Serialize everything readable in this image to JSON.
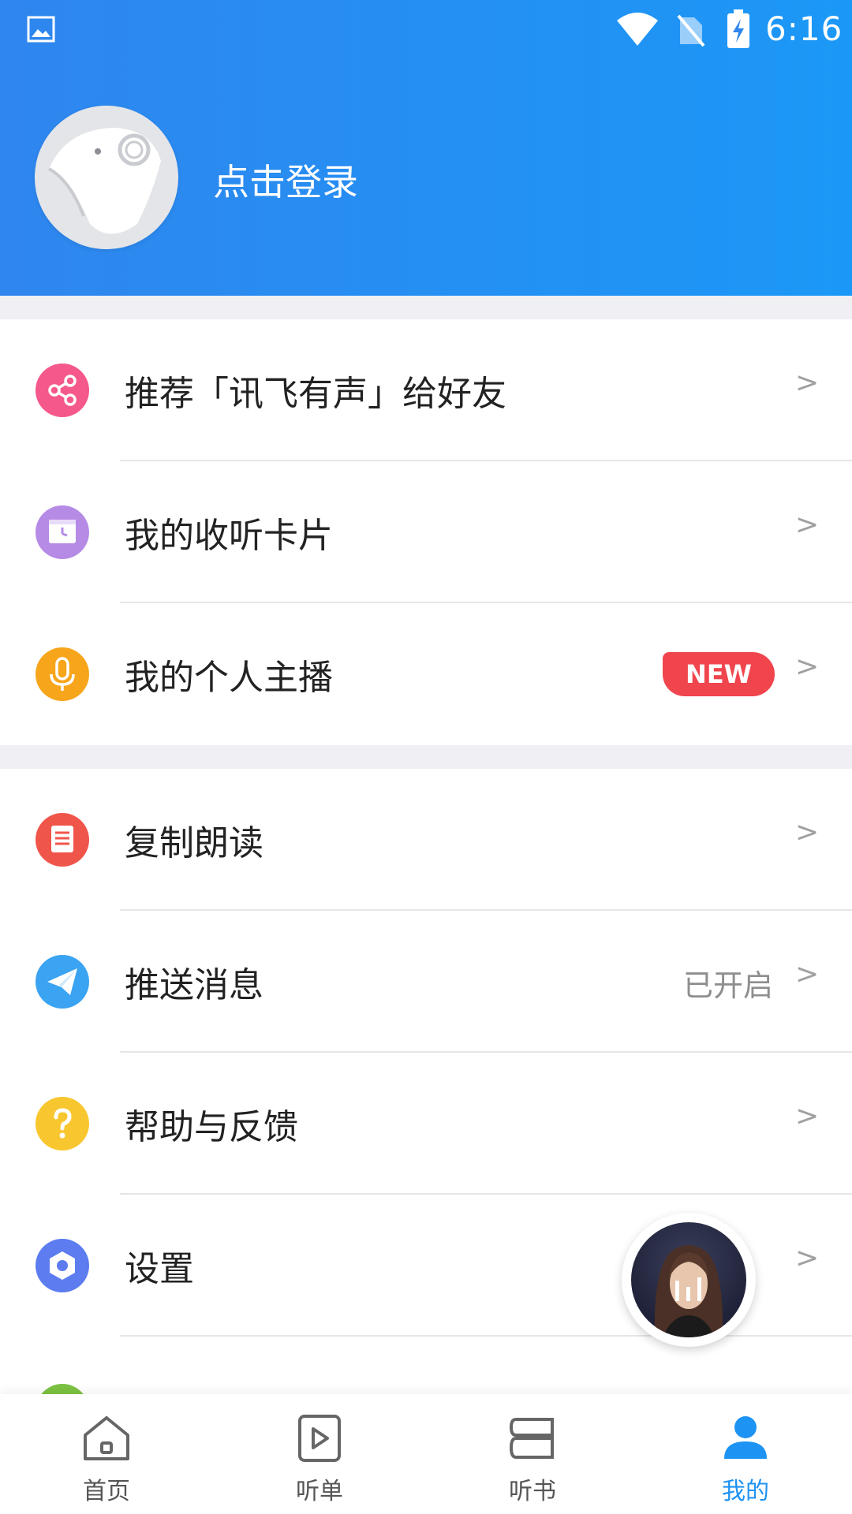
{
  "status_bar": {
    "time": "6:16"
  },
  "profile": {
    "login_label": "点击登录"
  },
  "section1": [
    {
      "label": "推荐「讯飞有声」给好友",
      "icon": "share-icon",
      "color": "#f5588a"
    },
    {
      "label": "我的收听卡片",
      "icon": "clock-card-icon",
      "color": "#b58be6"
    },
    {
      "label": "我的个人主播",
      "icon": "microphone-icon",
      "color": "#f7a51b",
      "badge": "NEW"
    }
  ],
  "section2": [
    {
      "label": "复制朗读",
      "icon": "document-icon",
      "color": "#f0554a"
    },
    {
      "label": "推送消息",
      "icon": "paper-plane-icon",
      "color": "#3aa3f2",
      "status": "已开启"
    },
    {
      "label": "帮助与反馈",
      "icon": "question-icon",
      "color": "#f8c62f"
    },
    {
      "label": "设置",
      "icon": "gear-icon",
      "color": "#5c7cf0"
    }
  ],
  "chevron": ">",
  "bottom_nav": [
    {
      "label": "首页",
      "icon": "home-icon",
      "active": false
    },
    {
      "label": "听单",
      "icon": "play-list-icon",
      "active": false
    },
    {
      "label": "听书",
      "icon": "book-icon",
      "active": false
    },
    {
      "label": "我的",
      "icon": "user-icon",
      "active": true
    }
  ],
  "colors": {
    "header_blue": "#1d93f3",
    "badge_red": "#f0454d",
    "active_tab": "#1d93f3"
  }
}
